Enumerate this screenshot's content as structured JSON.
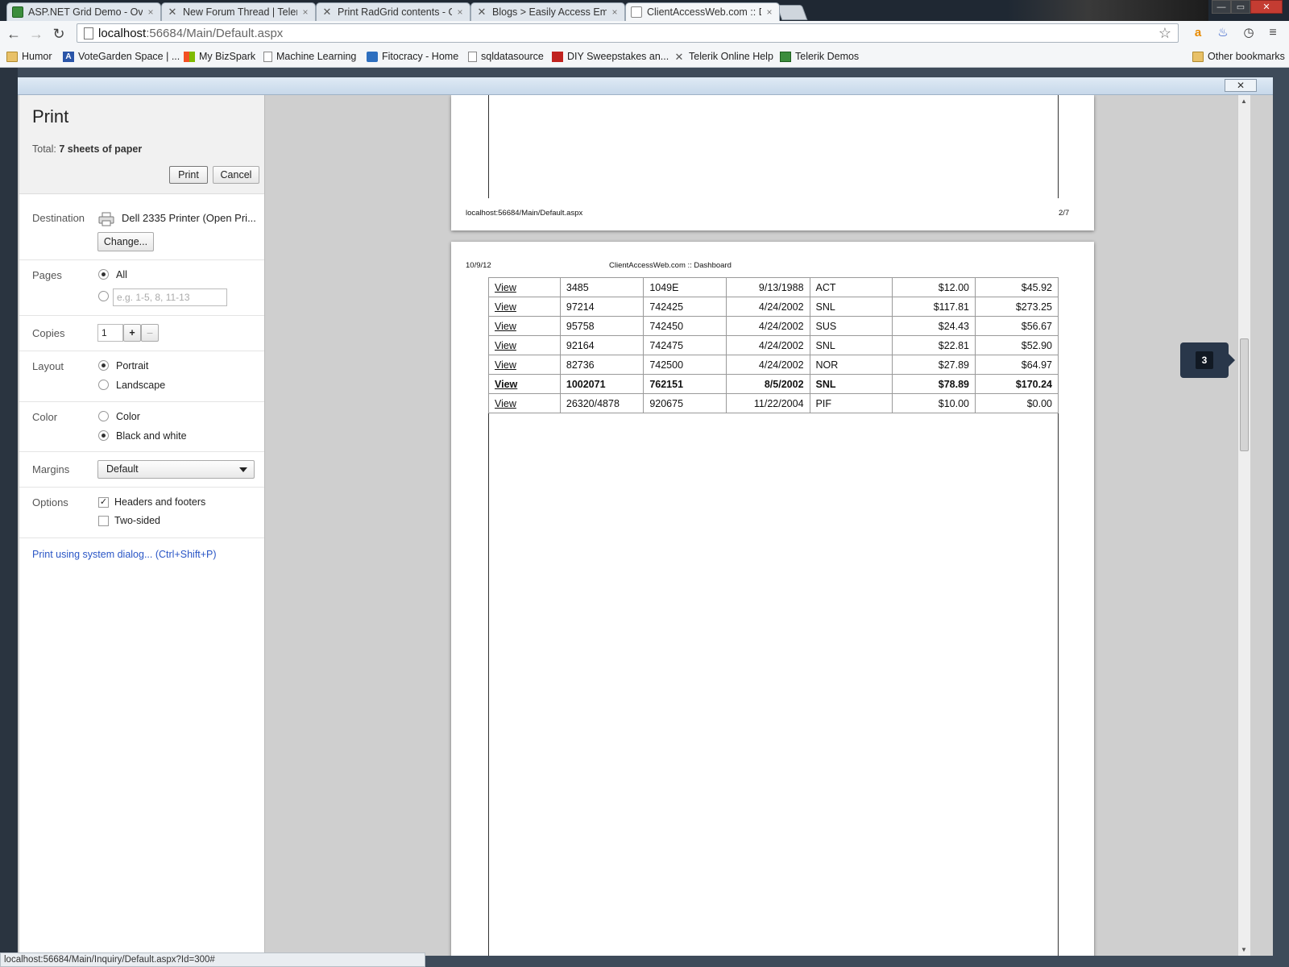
{
  "browser": {
    "tabs": [
      {
        "title": "ASP.NET Grid Demo - Over",
        "icon": "grid-icon",
        "active": false
      },
      {
        "title": "New Forum Thread | Teler",
        "icon": "telerik-icon",
        "active": false
      },
      {
        "title": "Print RadGrid contents - Gr",
        "icon": "telerik-icon",
        "active": false
      },
      {
        "title": "Blogs > Easily Access Emb",
        "icon": "telerik-icon",
        "active": false
      },
      {
        "title": "ClientAccessWeb.com :: Da",
        "icon": "page-icon",
        "active": true
      }
    ],
    "tab_close": "×",
    "window_buttons": [
      "—",
      "▭",
      "✕"
    ],
    "url_host": "localhost",
    "url_path": ":56684/Main/Default.aspx",
    "bookmarks": [
      {
        "label": "Humor",
        "icon": "folder-icon"
      },
      {
        "label": "VoteGarden Space | ...",
        "icon": "votegarden-icon"
      },
      {
        "label": "My BizSpark",
        "icon": "microsoft-icon"
      },
      {
        "label": "Machine Learning",
        "icon": "page-icon"
      },
      {
        "label": "Fitocracy - Home",
        "icon": "fitocracy-icon"
      },
      {
        "label": "sqldatasource",
        "icon": "page-icon"
      },
      {
        "label": "DIY Sweepstakes an...",
        "icon": "diy-icon"
      },
      {
        "label": "Telerik Online Help",
        "icon": "telerik-icon"
      },
      {
        "label": "Telerik Demos",
        "icon": "telerik-demos-icon"
      }
    ],
    "other_bookmarks": "Other bookmarks",
    "status_url": "localhost:56684/Main/Inquiry/Default.aspx?Id=300#"
  },
  "print": {
    "title": "Print",
    "total_label": "Total:",
    "total_value": "7 sheets of paper",
    "print_button": "Print",
    "cancel_button": "Cancel",
    "destination_label": "Destination",
    "destination_value": "Dell 2335 Printer (Open Pri...",
    "change_button": "Change...",
    "pages_label": "Pages",
    "pages_all": "All",
    "pages_placeholder": "e.g. 1-5, 8, 11-13",
    "copies_label": "Copies",
    "copies_value": "1",
    "copies_plus": "+",
    "copies_minus": "–",
    "layout_label": "Layout",
    "layout_portrait": "Portrait",
    "layout_landscape": "Landscape",
    "color_label": "Color",
    "color_color": "Color",
    "color_bw": "Black and white",
    "margins_label": "Margins",
    "margins_value": "Default",
    "options_label": "Options",
    "opt_headers": "Headers and footers",
    "opt_two_sided": "Two-sided",
    "system_dialog": "Print using system dialog... (Ctrl+Shift+P)",
    "overlay_close": "✕"
  },
  "preview": {
    "page2_footer_left": "localhost:56684/Main/Default.aspx",
    "page2_footer_right": "2/7",
    "page3_date": "10/9/12",
    "page3_title": "ClientAccessWeb.com :: Dashboard",
    "current_page": "3",
    "rows": [
      {
        "link": "View",
        "c1": "3485",
        "c2": "1049E",
        "date": "9/13/1988",
        "code": "ACT",
        "a1": "$12.00",
        "a2": "$45.92",
        "bold": false
      },
      {
        "link": "View",
        "c1": "97214",
        "c2": "742425",
        "date": "4/24/2002",
        "code": "SNL",
        "a1": "$117.81",
        "a2": "$273.25",
        "bold": false
      },
      {
        "link": "View",
        "c1": "95758",
        "c2": "742450",
        "date": "4/24/2002",
        "code": "SUS",
        "a1": "$24.43",
        "a2": "$56.67",
        "bold": false
      },
      {
        "link": "View",
        "c1": "92164",
        "c2": "742475",
        "date": "4/24/2002",
        "code": "SNL",
        "a1": "$22.81",
        "a2": "$52.90",
        "bold": false
      },
      {
        "link": "View",
        "c1": "82736",
        "c2": "742500",
        "date": "4/24/2002",
        "code": "NOR",
        "a1": "$27.89",
        "a2": "$64.97",
        "bold": false
      },
      {
        "link": "View",
        "c1": "1002071",
        "c2": "762151",
        "date": "8/5/2002",
        "code": "SNL",
        "a1": "$78.89",
        "a2": "$170.24",
        "bold": true
      },
      {
        "link": "View",
        "c1": "26320/4878",
        "c2": "920675",
        "date": "11/22/2004",
        "code": "PIF",
        "a1": "$10.00",
        "a2": "$0.00",
        "bold": false
      }
    ]
  }
}
